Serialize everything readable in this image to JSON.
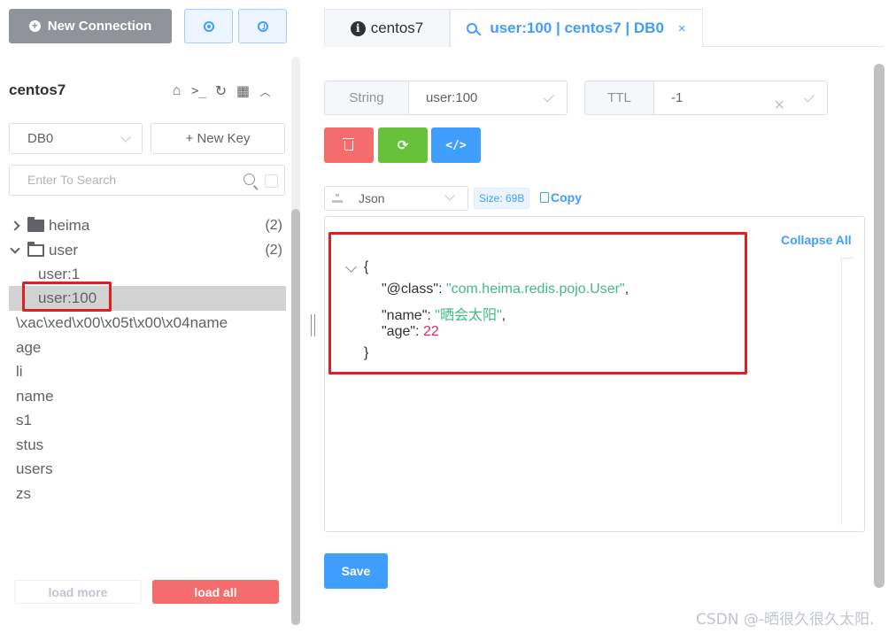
{
  "toolbar": {
    "new_connection_label": "New Connection",
    "new_connection_icon": "plus-circle-icon",
    "settings_icon": "gear-icon",
    "history_icon": "clock-icon"
  },
  "connection": {
    "name": "centos7",
    "icons": [
      "home-icon",
      "terminal-icon",
      "refresh-icon",
      "grid-icon",
      "chevron-up-icon"
    ],
    "db_select": "DB0",
    "new_key_label": "+ New Key",
    "search_placeholder": "Enter To Search"
  },
  "key_tree": [
    {
      "label": "heima",
      "type": "folder",
      "expanded": false,
      "count": "(2)"
    },
    {
      "label": "user",
      "type": "folder",
      "expanded": true,
      "count": "(2)"
    },
    {
      "label": "user:1",
      "type": "key",
      "indent": true
    },
    {
      "label": "user:100",
      "type": "key",
      "indent": true,
      "selected": true
    },
    {
      "label": "\\xac\\xed\\x00\\x05t\\x00\\x04name",
      "type": "key"
    },
    {
      "label": "age",
      "type": "key"
    },
    {
      "label": "li",
      "type": "key"
    },
    {
      "label": "name",
      "type": "key"
    },
    {
      "label": "s1",
      "type": "key"
    },
    {
      "label": "stus",
      "type": "key"
    },
    {
      "label": "users",
      "type": "key"
    },
    {
      "label": "zs",
      "type": "key"
    }
  ],
  "footer": {
    "load_more": "load more",
    "load_all": "load all"
  },
  "tabs": [
    {
      "label": "centos7",
      "icon": "info-icon",
      "active": false
    },
    {
      "label": "user:100 | centos7 | DB0",
      "icon": "key-icon",
      "active": true,
      "close": "×"
    }
  ],
  "key_detail": {
    "type": "String",
    "key_name": "user:100",
    "ttl_label": "TTL",
    "ttl_value": "-1",
    "actions": [
      "delete-icon",
      "refresh-icon",
      "code-icon"
    ],
    "format": "Json",
    "size": "Size: 69B",
    "copy_label": "Copy",
    "collapse_all": "Collapse All",
    "json": {
      "open": "{",
      "class_key": "\"@class\"",
      "class_val": "\"com.heima.redis.pojo.User\"",
      "name_key": "\"name\"",
      "name_val": "\"晒会太阳\"",
      "age_key": "\"age\"",
      "age_val": "22",
      "close": "}"
    },
    "save_label": "Save"
  },
  "watermark": "CSDN @-晒很久很久太阳.",
  "colors": {
    "primary": "#409eff",
    "danger": "#f56c6c",
    "success": "#67c23a",
    "highlight": "#e02020"
  }
}
